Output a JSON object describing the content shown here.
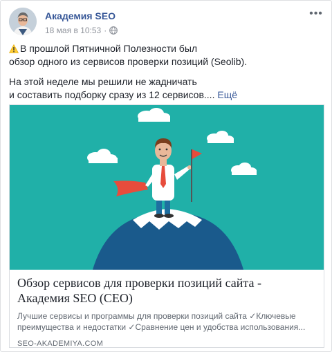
{
  "post": {
    "page_name": "Академия SEO",
    "timestamp": "18 мая в 10:53",
    "separator": "·",
    "more_label": "•••",
    "paragraph1_line1": "В прошлой Пятничной Полезности был",
    "paragraph1_line2": "обзор одного из сервисов проверки позиций (Seolib).",
    "paragraph2_line1": "На этой неделе мы решили не жадничать",
    "paragraph2_line2": "и составить подборку сразу из 12 сервисов....",
    "see_more": "Ещё"
  },
  "link_card": {
    "title_line1": "Обзор сервисов для проверки позиций сайта -",
    "title_line2": "Академия SEO (СЕО)",
    "desc_line1": "Лучшие сервисы и программы для проверки позиций сайта ✓Ключевые",
    "desc_line2": "преимущества и недостатки ✓Сравнение цен и удобства использования...",
    "domain": "SEO-AKADEMIYA.COM"
  },
  "colors": {
    "link_blue": "#385898",
    "image_background": "#20b0a8",
    "flag_red": "#e74c3c"
  },
  "icons": [
    "warning-icon",
    "globe-icon",
    "more-options-icon"
  ]
}
